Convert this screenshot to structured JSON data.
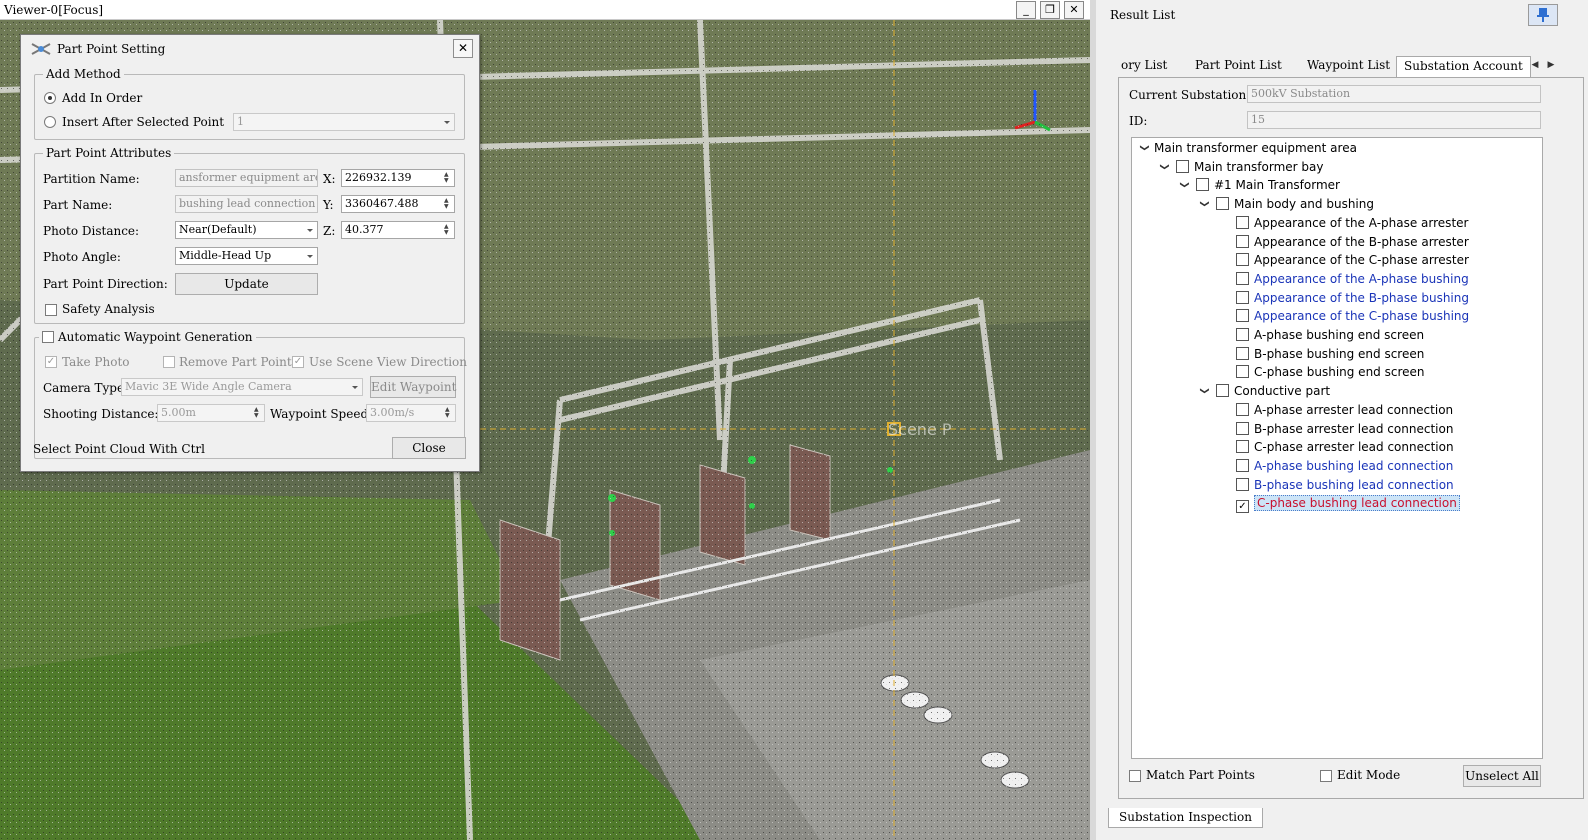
{
  "viewer": {
    "title": "Viewer-0[Focus]",
    "scene_caption": "Scene P",
    "buttons": [
      "_",
      "❐",
      "✕"
    ]
  },
  "dialog": {
    "title": "Part Point Setting",
    "close_glyph": "✕",
    "add_method": {
      "title": "Add Method",
      "add_in_order": "Add In Order",
      "insert_after": "Insert After Selected Point",
      "insert_after_value": "1"
    },
    "attributes": {
      "title": "Part Point Attributes",
      "partition_name_label": "Partition Name:",
      "partition_name_value": "ansformer equipment area",
      "part_name_label": "Part Name:",
      "part_name_value": "bushing lead connection",
      "photo_distance_label": "Photo Distance:",
      "photo_distance_value": "Near(Default)",
      "photo_angle_label": "Photo Angle:",
      "photo_angle_value": "Middle-Head Up",
      "direction_label": "Part Point Direction:",
      "update_button": "Update",
      "safety_label": "Safety Analysis",
      "x_label": "X:",
      "x_value": "226932.139",
      "y_label": "Y:",
      "y_value": "3360467.488",
      "z_label": "Z:",
      "z_value": "40.377"
    },
    "waypoint": {
      "title": "Automatic Waypoint Generation",
      "take_photo": "Take Photo",
      "remove_part_point": "Remove Part Point",
      "use_scene_view": "Use Scene View Direction",
      "camera_type_label": "Camera Type:",
      "camera_type_value": "Mavic 3E Wide Angle Camera",
      "edit_waypoint_button": "Edit Waypoint",
      "shooting_distance_label": "Shooting Distance:",
      "shooting_distance_value": "5.00m",
      "waypoint_speed_label": "Waypoint Speed:",
      "waypoint_speed_value": "3.00m/s"
    },
    "hint": "Select Point Cloud With Ctrl",
    "close_button": "Close"
  },
  "panel": {
    "title": "Result List",
    "tabs": [
      "ory List",
      "Part Point List",
      "Waypoint List",
      "Substation Account"
    ],
    "active_tab": 3,
    "current_substation_label": "Current Substation:",
    "current_substation_value": "500kV Substation",
    "id_label": "ID:",
    "id_value": "15",
    "tree": [
      {
        "level": 0,
        "label": "Main transformer equipment area",
        "expanded": true,
        "checkbox": false
      },
      {
        "level": 1,
        "label": "Main transformer bay",
        "expanded": true,
        "checkbox": true,
        "checked": false
      },
      {
        "level": 2,
        "label": "#1 Main Transformer",
        "expanded": true,
        "checkbox": true,
        "checked": false
      },
      {
        "level": 3,
        "label": "Main body and bushing",
        "expanded": true,
        "checkbox": true,
        "checked": false
      },
      {
        "level": 4,
        "label": "Appearance of the A-phase arrester",
        "checkbox": true,
        "checked": false
      },
      {
        "level": 4,
        "label": "Appearance of the B-phase arrester",
        "checkbox": true,
        "checked": false
      },
      {
        "level": 4,
        "label": "Appearance of the C-phase arrester",
        "checkbox": true,
        "checked": false
      },
      {
        "level": 4,
        "label": "Appearance of the A-phase bushing",
        "checkbox": true,
        "checked": false,
        "color": "blue"
      },
      {
        "level": 4,
        "label": "Appearance of the B-phase bushing",
        "checkbox": true,
        "checked": false,
        "color": "blue"
      },
      {
        "level": 4,
        "label": "Appearance of the C-phase bushing",
        "checkbox": true,
        "checked": false,
        "color": "blue"
      },
      {
        "level": 4,
        "label": "A-phase bushing end screen",
        "checkbox": true,
        "checked": false
      },
      {
        "level": 4,
        "label": "B-phase bushing end screen",
        "checkbox": true,
        "checked": false
      },
      {
        "level": 4,
        "label": "C-phase bushing end screen",
        "checkbox": true,
        "checked": false
      },
      {
        "level": 3,
        "label": "Conductive part",
        "expanded": true,
        "checkbox": true,
        "checked": false
      },
      {
        "level": 4,
        "label": "A-phase arrester lead connection",
        "checkbox": true,
        "checked": false
      },
      {
        "level": 4,
        "label": "B-phase arrester lead connection",
        "checkbox": true,
        "checked": false
      },
      {
        "level": 4,
        "label": "C-phase arrester lead connection",
        "checkbox": true,
        "checked": false
      },
      {
        "level": 4,
        "label": "A-phase bushing lead connection",
        "checkbox": true,
        "checked": false,
        "color": "blue"
      },
      {
        "level": 4,
        "label": "B-phase bushing lead connection",
        "checkbox": true,
        "checked": false,
        "color": "blue"
      },
      {
        "level": 4,
        "label": "C-phase bushing lead connection",
        "checkbox": true,
        "checked": true,
        "selected": true
      }
    ],
    "match_part_points": "Match Part Points",
    "edit_mode": "Edit Mode",
    "unselect_all": "Unselect All",
    "bottom_tab": "Substation Inspection"
  },
  "colors": {
    "link_blue": "#1a34b8",
    "selected_red": "#c8102e",
    "selection_bg": "#cce4f7"
  }
}
